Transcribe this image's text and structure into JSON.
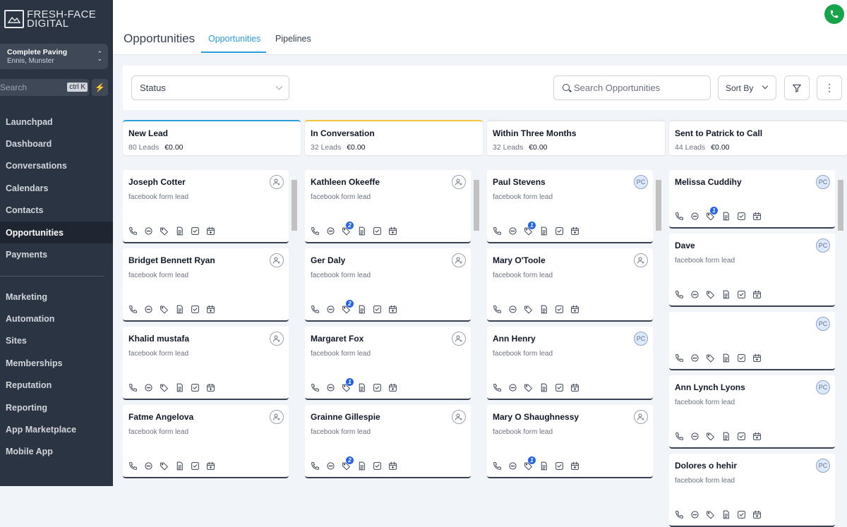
{
  "brand": {
    "line1": "FRESH-FACE",
    "line2": "DIGITAL"
  },
  "account": {
    "name": "Complete Paving",
    "location": "Ennis, Munster"
  },
  "search": {
    "placeholder": "Search",
    "shortcut": "ctrl K"
  },
  "nav_primary": [
    "Launchpad",
    "Dashboard",
    "Conversations",
    "Calendars",
    "Contacts",
    "Opportunities",
    "Payments"
  ],
  "nav_secondary": [
    "Marketing",
    "Automation",
    "Sites",
    "Memberships",
    "Reputation",
    "Reporting",
    "App Marketplace",
    "Mobile App"
  ],
  "active_nav": "Opportunities",
  "header": {
    "title": "Opportunities",
    "tabs": [
      "Opportunities",
      "Pipelines"
    ],
    "active_tab": "Opportunities"
  },
  "filters": {
    "status_placeholder": "Status",
    "search_placeholder": "Search Opportunities",
    "sort_label": "Sort By"
  },
  "colors": {
    "accent": "#2d9cdb",
    "sidebar": "#2b3442",
    "badge": "#2563eb",
    "phone": "#16a34a"
  },
  "columns": [
    {
      "title": "New Lead",
      "count": "80 Leads",
      "value": "€0.00",
      "accent": "#2d9cdb",
      "cards": [
        {
          "name": "Joseph Cotter",
          "source": "facebook form lead",
          "owner": "",
          "badge": ""
        },
        {
          "name": "Bridget Bennett Ryan",
          "source": "facebook form lead",
          "owner": "",
          "badge": ""
        },
        {
          "name": "Khalid mustafa",
          "source": "facebook form lead",
          "owner": "",
          "badge": ""
        },
        {
          "name": "Fatme Angelova",
          "source": "facebook form lead",
          "owner": "",
          "badge": ""
        }
      ]
    },
    {
      "title": "In Conversation",
      "count": "32 Leads",
      "value": "€0.00",
      "accent": "#f5c542",
      "cards": [
        {
          "name": "Kathleen Okeeffe",
          "source": "facebook form lead",
          "owner": "",
          "badge": "2"
        },
        {
          "name": "Ger Daly",
          "source": "facebook form lead",
          "owner": "",
          "badge": "2"
        },
        {
          "name": "Margaret Fox",
          "source": "facebook form lead",
          "owner": "",
          "badge": "1"
        },
        {
          "name": "Grainne Gillespie",
          "source": "facebook form lead",
          "owner": "",
          "badge": "2"
        }
      ]
    },
    {
      "title": "Within Three Months",
      "count": "32 Leads",
      "value": "€0.00",
      "accent": "#e5e7eb",
      "cards": [
        {
          "name": "Paul Stevens",
          "source": "facebook form lead",
          "owner": "PC",
          "badge": "1"
        },
        {
          "name": "Mary O'Toole",
          "source": "facebook form lead",
          "owner": "",
          "badge": ""
        },
        {
          "name": "Ann Henry",
          "source": "facebook form lead",
          "owner": "PC",
          "badge": ""
        },
        {
          "name": "Mary O Shaughnessy",
          "source": "facebook form lead",
          "owner": "",
          "badge": "1"
        }
      ]
    },
    {
      "title": "Sent to Patrick to Call",
      "count": "44 Leads",
      "value": "€0.00",
      "accent": "#e5e7eb",
      "cards": [
        {
          "name": "Melissa Cuddihy",
          "source": "",
          "owner": "PC",
          "badge": "1"
        },
        {
          "name": "Dave",
          "source": "facebook form lead",
          "owner": "PC",
          "badge": ""
        },
        {
          "name": "",
          "source": "",
          "owner": "PC",
          "badge": ""
        },
        {
          "name": "Ann Lynch Lyons",
          "source": "facebook form lead",
          "owner": "PC",
          "badge": ""
        },
        {
          "name": "Dolores o hehir",
          "source": "facebook form lead",
          "owner": "PC",
          "badge": ""
        }
      ]
    }
  ]
}
